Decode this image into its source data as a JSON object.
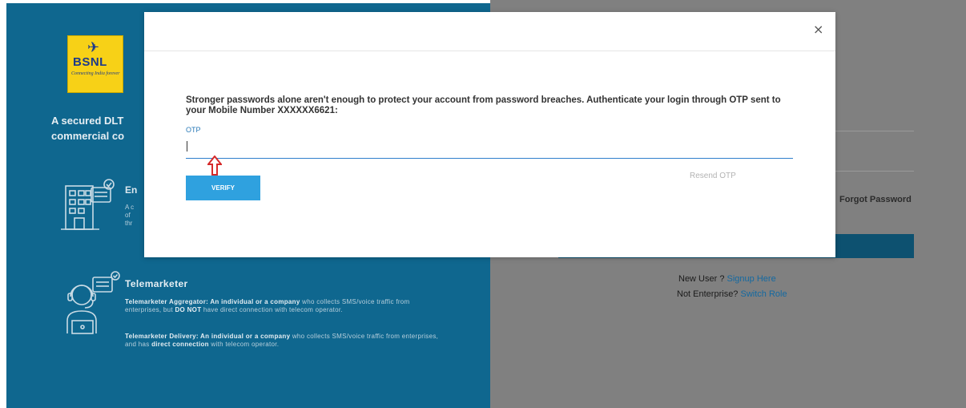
{
  "brand": {
    "logo_text": "BSNL",
    "logo_tagline": "Connecting India forever",
    "colors": {
      "panel_blue": "#0f678f",
      "logo_yellow": "#f7d117",
      "accent": "#2fa1df"
    }
  },
  "left_panel": {
    "tagline_line1": "A secured DLT",
    "tagline_line2": "commercial co",
    "enterprise": {
      "title": "En",
      "desc_line1": "A c",
      "desc_line2": "of",
      "desc_line3": "thr"
    },
    "telemarketer": {
      "title": "Telemarketer",
      "aggregator": {
        "bold_lead": "Telemarketer Aggregator: An individual or a company",
        "text1": " who collects SMS/voice traffic from enterprises, but ",
        "bold_mid": "DO NOT",
        "text2": " have direct connection with telecom operator."
      },
      "delivery": {
        "bold_lead": "Telemarketer Delivery: An individual or a company",
        "text1": " who collects SMS/voice traffic from enterprises, and has ",
        "bold_mid": "direct connection",
        "text2": " with telecom operator."
      }
    }
  },
  "right_panel": {
    "forgot_password": "Forgot Password",
    "new_user_text": "New User ? ",
    "signup_link": "Signup Here",
    "not_enterprise_text": "Not Enterprise? ",
    "switch_role_link": "Switch Role"
  },
  "modal": {
    "close_label": "×",
    "message": "Stronger passwords alone aren't enough to protect your account from password breaches. Authenticate your login through OTP sent to your Mobile Number XXXXXX6621:",
    "otp_label": "OTP",
    "otp_value": "",
    "resend_label": "Resend OTP",
    "verify_label": "VERIFY"
  }
}
